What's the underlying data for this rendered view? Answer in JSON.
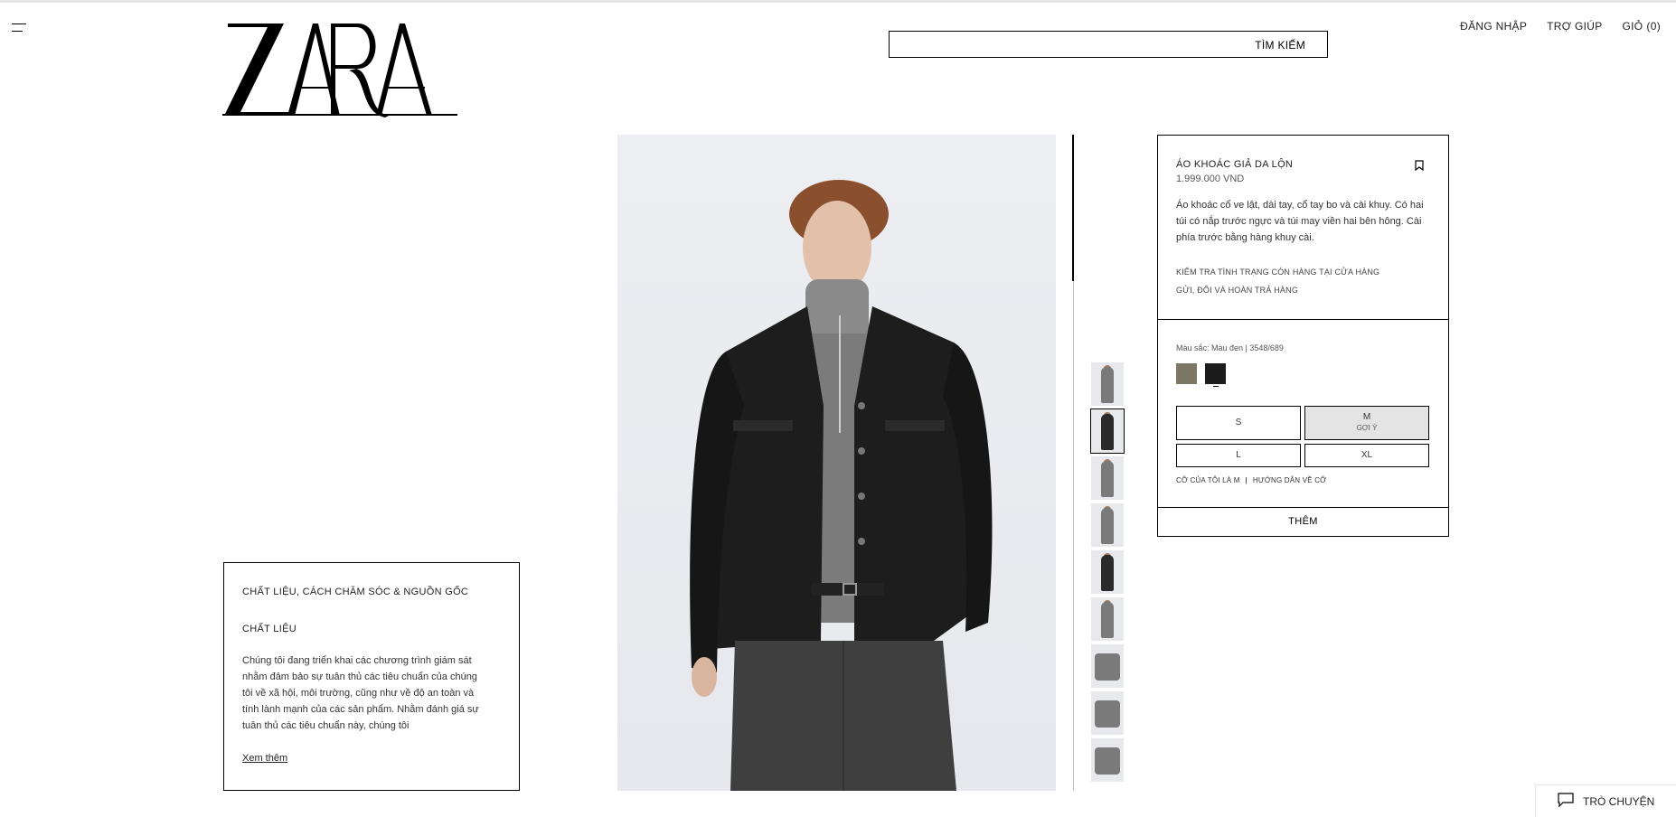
{
  "header": {
    "menu_icon": "hamburger-icon",
    "logo_text": "ZARA",
    "search_label": "TÌM KIẾM",
    "login_label": "ĐĂNG NHẬP",
    "help_label": "TRỢ GIÚP",
    "cart_label": "GIỎ",
    "cart_count": "(0)"
  },
  "product": {
    "name": "ÁO KHOÁC GIẢ DA LỘN",
    "price": "1.999.000 VND",
    "description": "Áo khoác cổ ve lật, dài tay, cổ tay bo và cài khuy. Có hai túi có nắp trước ngực và túi may viền hai bên hông. Cài phía trước bằng hàng khuy cài.",
    "store_availability_link": "KIỂM TRA TÌNH TRẠNG CÒN HÀNG TẠI CỬA HÀNG",
    "shipping_link": "GỬI, ĐỔI VÀ HOÀN TRẢ HÀNG",
    "color_text": "Màu sắc: Màu đen | 3548/689",
    "colors": [
      {
        "name": "olive",
        "hex": "#7d7866"
      },
      {
        "name": "black",
        "hex": "#1c1c1c"
      }
    ],
    "sizes": {
      "s": "S",
      "m": "M",
      "m_hint": "GỢI Ý",
      "l": "L",
      "xl": "XL"
    },
    "my_size_text": "CỠ CỦA TÔI LÀ M",
    "size_guide_link": "HƯỚNG DẪN VỀ CỠ",
    "add_button": "THÊM"
  },
  "material": {
    "title": "CHẤT LIỆU, CÁCH CHĂM SÓC & NGUỒN GỐC",
    "subtitle": "CHẤT LIỆU",
    "body": "Chúng tôi đang triển khai các chương trình giám sát nhằm đảm bảo sự tuân thủ các tiêu chuẩn của chúng tôi về xã hội, môi trường, cũng như về độ an toàn và tính lành mạnh của các sản phẩm. Nhằm đánh giá sự tuân thủ các tiêu chuẩn này, chúng tôi",
    "more_link": "Xem thêm"
  },
  "chat": {
    "label": "TRÒ CHUYỆN",
    "icon": "chat-bubble-icon"
  }
}
